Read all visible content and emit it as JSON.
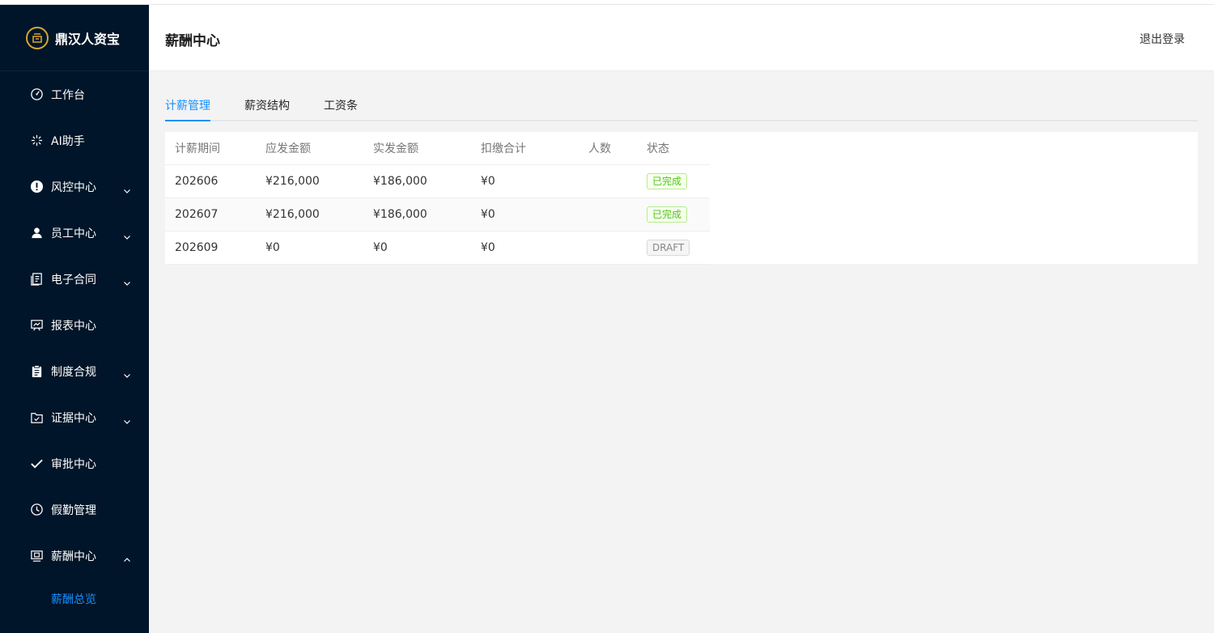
{
  "brand": {
    "name": "鼎汉人资宝"
  },
  "sidebar": {
    "items": [
      {
        "label": "工作台",
        "icon": "dashboard-icon",
        "expandable": false
      },
      {
        "label": "AI助手",
        "icon": "sparkle-icon",
        "expandable": false
      },
      {
        "label": "风控中心",
        "icon": "alert-icon",
        "expandable": true
      },
      {
        "label": "员工中心",
        "icon": "user-icon",
        "expandable": true
      },
      {
        "label": "电子合同",
        "icon": "contract-icon",
        "expandable": true
      },
      {
        "label": "报表中心",
        "icon": "report-icon",
        "expandable": false
      },
      {
        "label": "制度合规",
        "icon": "clipboard-icon",
        "expandable": true
      },
      {
        "label": "证据中心",
        "icon": "evidence-icon",
        "expandable": true
      },
      {
        "label": "审批中心",
        "icon": "check-icon",
        "expandable": false
      },
      {
        "label": "假勤管理",
        "icon": "clock-icon",
        "expandable": false
      },
      {
        "label": "薪酬中心",
        "icon": "salary-icon",
        "expandable": true,
        "expanded": true
      }
    ],
    "subitems": [
      {
        "label": "薪酬总览",
        "active": true
      }
    ]
  },
  "header": {
    "title": "薪酬中心",
    "logout_label": "退出登录"
  },
  "tabs": [
    {
      "label": "计薪管理",
      "active": true
    },
    {
      "label": "薪资结构",
      "active": false
    },
    {
      "label": "工资条",
      "active": false
    }
  ],
  "table": {
    "columns": [
      "计薪期间",
      "应发金额",
      "实发金额",
      "扣缴合计",
      "人数",
      "状态"
    ],
    "rows": [
      {
        "period": "202606",
        "gross": "¥216,000",
        "net": "¥186,000",
        "deduction": "¥0",
        "headcount": "",
        "status": "已完成",
        "status_type": "done"
      },
      {
        "period": "202607",
        "gross": "¥216,000",
        "net": "¥186,000",
        "deduction": "¥0",
        "headcount": "",
        "status": "已完成",
        "status_type": "done"
      },
      {
        "period": "202609",
        "gross": "¥0",
        "net": "¥0",
        "deduction": "¥0",
        "headcount": "",
        "status": "DRAFT",
        "status_type": "draft"
      }
    ]
  },
  "colors": {
    "sidebar_bg": "#001529",
    "accent": "#1890ff",
    "brand_gold": "#d4a829",
    "success": "#52c41a"
  }
}
